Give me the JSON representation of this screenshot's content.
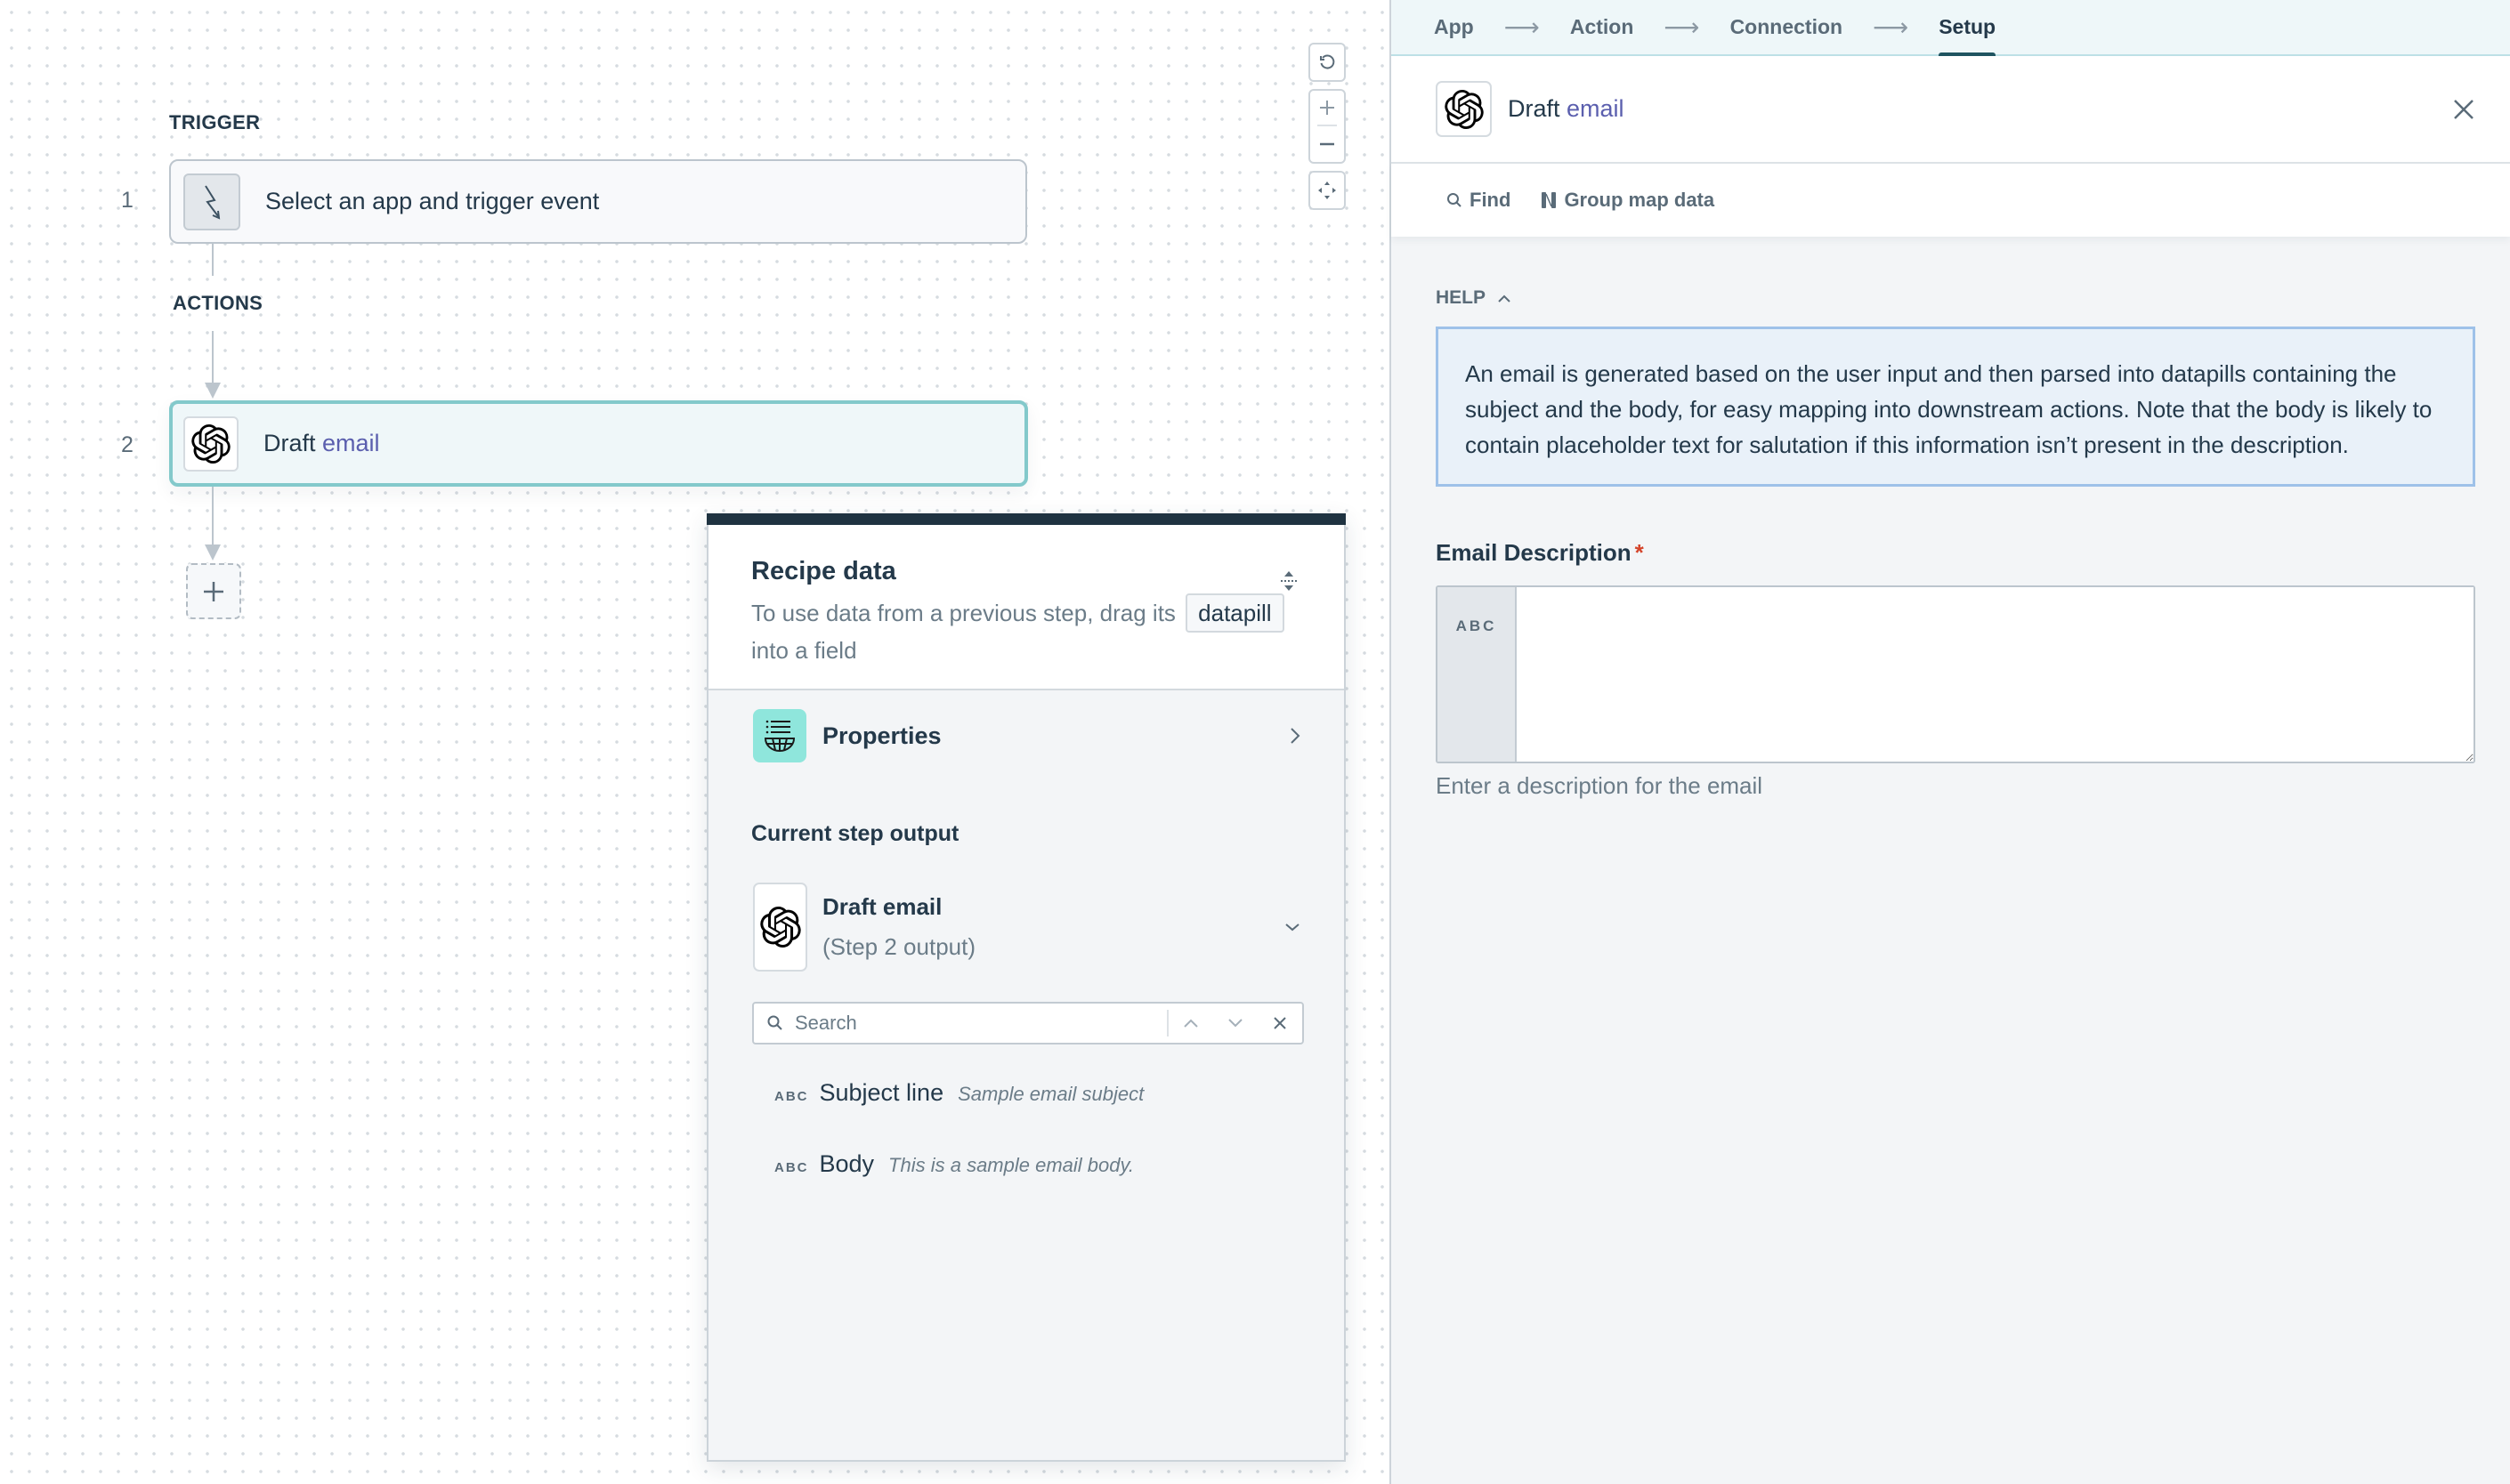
{
  "canvas": {
    "trigger_section_label": "TRIGGER",
    "actions_section_label": "ACTIONS",
    "steps": [
      {
        "number": "1",
        "text": "Select an app and trigger event",
        "icon": "lightning-icon"
      },
      {
        "number": "2",
        "text_prefix": "Draft",
        "text_accent": "email",
        "icon": "openai-icon"
      }
    ],
    "add_step_icon": "plus-icon",
    "controls": [
      "reset-icon",
      "zoom-in-icon",
      "zoom-out-icon",
      "fit-view-icon"
    ]
  },
  "recipe_data": {
    "title": "Recipe data",
    "description_prefix": "To use data from a previous step, drag its",
    "description_pill": "datapill",
    "description_suffix": "into a field",
    "properties_label": "Properties",
    "current_step_output_label": "Current step output",
    "output_step": {
      "name": "Draft email",
      "subtitle": "(Step 2 output)"
    },
    "search_placeholder": "Search",
    "pills": [
      {
        "type": "ABC",
        "name": "Subject line",
        "sample": "Sample email subject"
      },
      {
        "type": "ABC",
        "name": "Body",
        "sample": "This is a sample email body."
      }
    ]
  },
  "setup_panel": {
    "wizard_tabs": [
      {
        "label": "App",
        "active": false
      },
      {
        "label": "Action",
        "active": false
      },
      {
        "label": "Connection",
        "active": false
      },
      {
        "label": "Setup",
        "active": true
      }
    ],
    "wizard_arrow": "⟶",
    "header_title_prefix": "Draft",
    "header_title_accent": "email",
    "toolbar": {
      "find_label": "Find",
      "group_map_label": "Group map data"
    },
    "help_label": "HELP",
    "help_text": "An email is generated based on the user input and then parsed into datapills containing the subject and the body, for easy mapping into downstream actions. Note that the body is likely to contain placeholder text for salutation if this information isn’t present in the description.",
    "field": {
      "label": "Email Description",
      "required_marker": "*",
      "type_badge": "ABC",
      "value": "",
      "hint": "Enter a description for the email"
    }
  },
  "colors": {
    "accent_text": "#5b5fae",
    "active_step_border": "#83c9cb",
    "help_border": "#9ec1e9",
    "properties_icon_bg": "#8fe6dc",
    "required": "#d4442a",
    "recipe_topbar": "#1f3341"
  }
}
